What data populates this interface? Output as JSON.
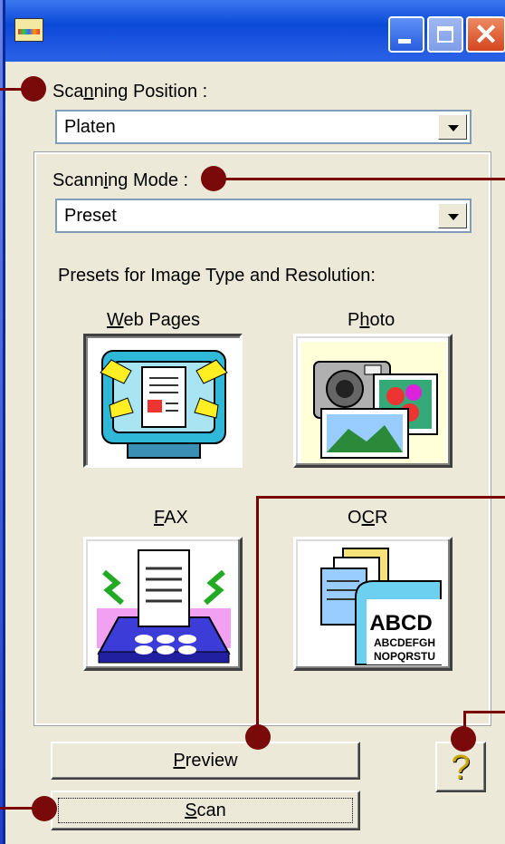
{
  "window": {
    "title": ""
  },
  "scanning_position": {
    "label_pre": "Sca",
    "label_accel": "n",
    "label_post": "ning Position :",
    "value": "Platen"
  },
  "scanning_mode": {
    "label_pre": "Scann",
    "label_accel": "i",
    "label_post": "ng Mode :",
    "value": "Preset"
  },
  "presets": {
    "heading": "Presets for Image Type and Resolution:",
    "items": [
      {
        "accel": "W",
        "rest": "eb Pages",
        "pre": "",
        "icon": "web-pages-icon"
      },
      {
        "pre": "P",
        "accel": "h",
        "rest": "oto",
        "icon": "photo-icon"
      },
      {
        "pre": "",
        "accel": "F",
        "rest": "AX",
        "icon": "fax-icon"
      },
      {
        "pre": "O",
        "accel": "C",
        "rest": "R",
        "icon": "ocr-icon"
      }
    ],
    "ocr_text": {
      "line1": "ABCD",
      "line2": "ABCDEFGH",
      "line3": "NOPQRSTU"
    }
  },
  "buttons": {
    "preview": {
      "accel": "P",
      "rest": "review"
    },
    "scan": {
      "accel": "S",
      "rest": "can"
    },
    "help": "?"
  },
  "colors": {
    "titlebar": "#0a4ad8",
    "callout": "#7a0a0a",
    "face": "#ece9d8"
  }
}
